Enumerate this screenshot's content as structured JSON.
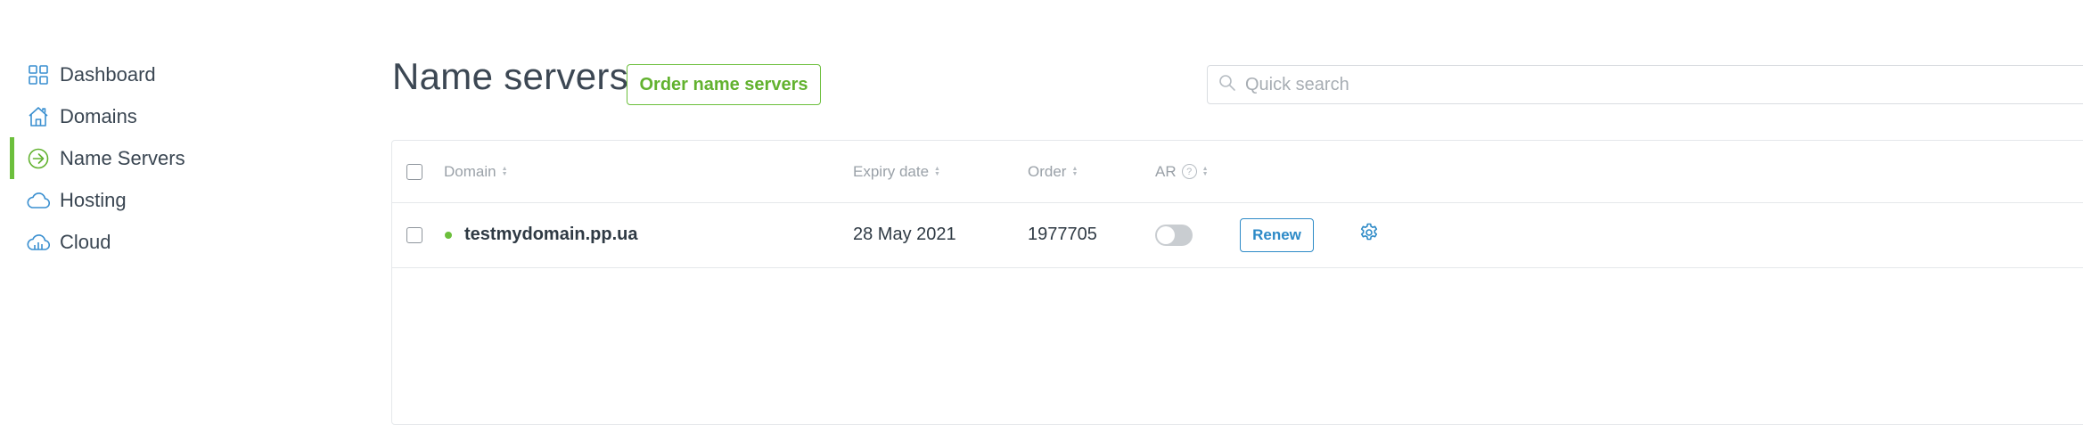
{
  "sidebar": {
    "items": [
      {
        "label": "Dashboard",
        "icon": "grid-icon",
        "active": false
      },
      {
        "label": "Domains",
        "icon": "house-icon",
        "active": false
      },
      {
        "label": "Name Servers",
        "icon": "arrow-circle-icon",
        "active": true
      },
      {
        "label": "Hosting",
        "icon": "cloud-icon",
        "active": false
      },
      {
        "label": "Cloud",
        "icon": "cloud-chart-icon",
        "active": false
      }
    ]
  },
  "header": {
    "title": "Name servers",
    "order_button": "Order name servers",
    "search_placeholder": "Quick search"
  },
  "table": {
    "columns": {
      "domain": "Domain",
      "expiry": "Expiry date",
      "order": "Order",
      "ar": "AR",
      "ar_help": "?"
    },
    "rows": [
      {
        "domain": "testmydomain.pp.ua",
        "status": "active",
        "expiry": "28 May 2021",
        "order": "1977705",
        "auto_renew": false,
        "renew_label": "Renew"
      }
    ]
  },
  "colors": {
    "accent_green": "#6cbf3c",
    "link_blue": "#2d8ac7",
    "icon_blue": "#3a8fd0"
  }
}
